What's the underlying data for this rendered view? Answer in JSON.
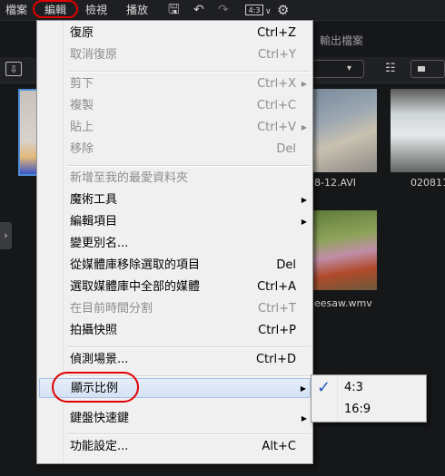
{
  "menubar": {
    "items": [
      "檔案",
      "編輯",
      "檢視",
      "播放"
    ],
    "ratio_label": "4:3"
  },
  "output_tab": "輸出檔案",
  "library": {
    "captions": [
      "8-12.AVI",
      "020811",
      "eesaw.wmv"
    ]
  },
  "edit_menu": {
    "items": [
      {
        "label": "復原",
        "shortcut": "Ctrl+Z",
        "disabled": false
      },
      {
        "label": "取消復原",
        "shortcut": "Ctrl+Y",
        "disabled": true
      },
      {
        "label": "剪下",
        "shortcut": "Ctrl+X",
        "disabled": true
      },
      {
        "label": "複製",
        "shortcut": "Ctrl+C",
        "disabled": true
      },
      {
        "label": "貼上",
        "shortcut": "Ctrl+V",
        "disabled": true
      },
      {
        "label": "移除",
        "shortcut": "Del",
        "disabled": true
      },
      {
        "label": "新增至我的最愛資料夾",
        "shortcut": "",
        "disabled": true
      },
      {
        "label": "魔術工具",
        "shortcut": "",
        "disabled": false
      },
      {
        "label": "編輯項目",
        "shortcut": "",
        "disabled": false
      },
      {
        "label": "變更別名...",
        "shortcut": "",
        "disabled": false
      },
      {
        "label": "從媒體庫移除選取的項目",
        "shortcut": "Del",
        "disabled": false
      },
      {
        "label": "選取媒體庫中全部的媒體",
        "shortcut": "Ctrl+A",
        "disabled": false
      },
      {
        "label": "在目前時間分割",
        "shortcut": "Ctrl+T",
        "disabled": true
      },
      {
        "label": "拍攝快照",
        "shortcut": "Ctrl+P",
        "disabled": false
      },
      {
        "label": "偵測場景...",
        "shortcut": "Ctrl+D",
        "disabled": false
      },
      {
        "label": "顯示比例",
        "shortcut": "",
        "disabled": false
      },
      {
        "label": "鍵盤快速鍵",
        "shortcut": "",
        "disabled": false
      },
      {
        "label": "功能設定...",
        "shortcut": "Alt+C",
        "disabled": false
      }
    ]
  },
  "ratio_submenu": {
    "items": [
      {
        "label": "4:3",
        "checked": true
      },
      {
        "label": "16:9",
        "checked": false
      }
    ]
  },
  "colors": {
    "highlight_ring": "#e00000",
    "menu_bg": "#f0f0f0",
    "check": "#2156c4"
  }
}
